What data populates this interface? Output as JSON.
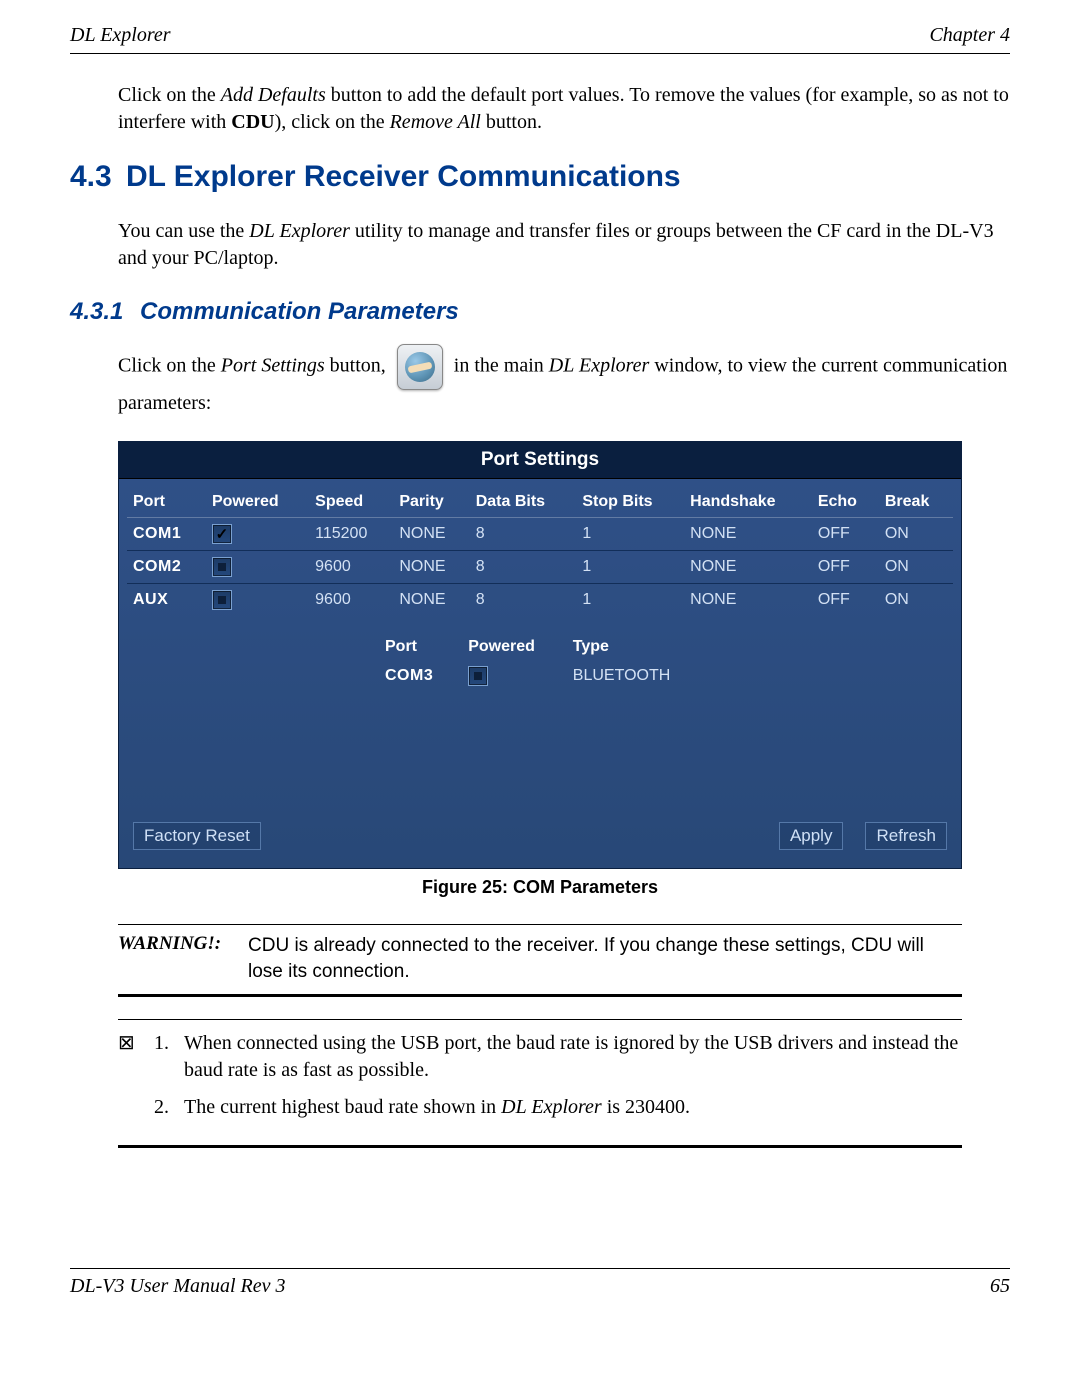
{
  "header": {
    "left": "DL Explorer",
    "right": "Chapter 4"
  },
  "intro": {
    "p1a": "Click on the ",
    "p1_add_defaults": "Add Defaults",
    "p1b": " button to add the default port values. To remove the values (for example, so as not to interfere with ",
    "p1_cdu": "CDU",
    "p1c": "), click on the ",
    "p1_remove_all": "Remove All",
    "p1d": " button."
  },
  "section": {
    "num": "4.3",
    "title": "DL Explorer Receiver Communications"
  },
  "section_para": {
    "a": "You can use the ",
    "dl": "DL Explorer",
    "b": " utility to manage and transfer files or groups between the CF card in the DL-V3 and your PC/laptop."
  },
  "subsection": {
    "num": "4.3.1",
    "title": "Communication Parameters"
  },
  "param_line": {
    "a": "Click on the ",
    "ps": "Port Settings",
    "b": " button, ",
    "c": " in the main ",
    "dl": "DL Explorer",
    "d": " window, to view the current communication parameters:"
  },
  "port_settings": {
    "title": "Port Settings",
    "headers": [
      "Port",
      "Powered",
      "Speed",
      "Parity",
      "Data Bits",
      "Stop Bits",
      "Handshake",
      "Echo",
      "Break"
    ],
    "rows": [
      {
        "port": "COM1",
        "powered": true,
        "speed": "115200",
        "parity": "NONE",
        "data": "8",
        "stop": "1",
        "hand": "NONE",
        "echo": "OFF",
        "break": "ON"
      },
      {
        "port": "COM2",
        "powered": false,
        "speed": "9600",
        "parity": "NONE",
        "data": "8",
        "stop": "1",
        "hand": "NONE",
        "echo": "OFF",
        "break": "ON"
      },
      {
        "port": "AUX",
        "powered": false,
        "speed": "9600",
        "parity": "NONE",
        "data": "8",
        "stop": "1",
        "hand": "NONE",
        "echo": "OFF",
        "break": "ON"
      }
    ],
    "sub_headers": [
      "Port",
      "Powered",
      "Type"
    ],
    "sub_row": {
      "port": "COM3",
      "powered": false,
      "type": "BLUETOOTH"
    },
    "buttons": {
      "reset": "Factory Reset",
      "apply": "Apply",
      "refresh": "Refresh"
    }
  },
  "figure_caption": " Figure 25: COM Parameters",
  "warning": {
    "label": "WARNING!:",
    "text": "CDU is already connected to the receiver. If you change these settings, CDU will lose its connection."
  },
  "notes": {
    "n1": {
      "num": "1.",
      "a": "When connected using the USB port, the baud rate is ignored by the USB drivers and instead the baud rate is as fast as possible."
    },
    "n2": {
      "num": "2.",
      "a": "The current highest baud rate shown in ",
      "dl": "DL Explorer",
      "b": " is 230400."
    }
  },
  "footer": {
    "left": "DL-V3 User Manual Rev 3",
    "right": "65"
  }
}
